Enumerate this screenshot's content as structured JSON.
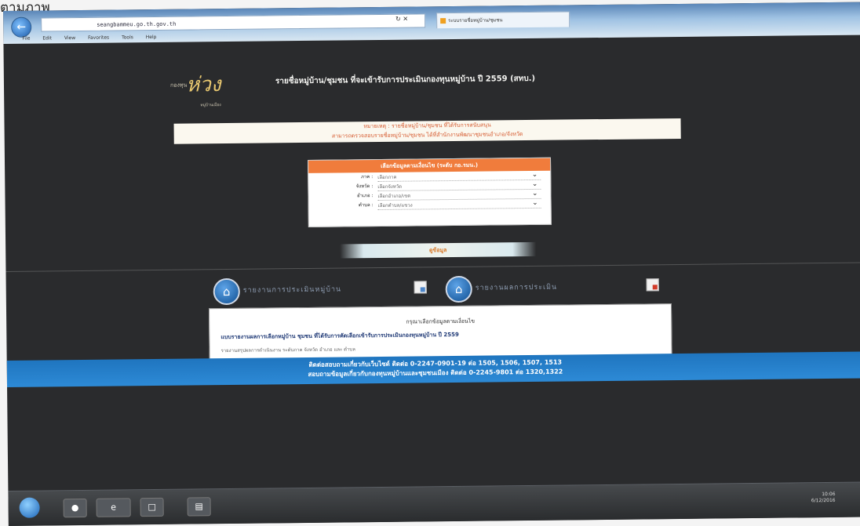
{
  "caption": "ตามภาพ",
  "browser": {
    "url": "seangbammeu.go.th.gov.th",
    "tab_label": "ระบบรายชื่อหมู่บ้าน/ชุมชน",
    "menu": [
      "File",
      "Edit",
      "View",
      "Favorites",
      "Tools",
      "Help"
    ]
  },
  "site": {
    "logo_top": "กองทุน",
    "logo_text": "ห่วง",
    "logo_sub": "หมู่บ้านเมือง",
    "title": "รายชื่อหมู่บ้าน/ชุมชน ที่จะเข้ารับการประเมินกองทุนหมู่บ้าน ปี 2559 (สทบ.)"
  },
  "notice": {
    "line1": "หมายเหตุ : รายชื่อหมู่บ้าน/ชุมชน ที่ได้รับการสนับสนุน",
    "line2": "สามารถตรวจสอบรายชื่อหมู่บ้าน/ชุมชน ได้ที่สำนักงานพัฒนาชุมชนอำเภอ/จังหวัด"
  },
  "form": {
    "title": "เลือกข้อมูลตามเงื่อนไข (ระดับ กอ.รมน.)",
    "rows": [
      {
        "label": "ภาค :",
        "value": "เลือกภาค"
      },
      {
        "label": "จังหวัด :",
        "value": "เลือกจังหวัด"
      },
      {
        "label": "อำเภอ :",
        "value": "เลือกอำเภอ/เขต"
      },
      {
        "label": "ตำบล :",
        "value": "เลือกตำบล/แขวง"
      }
    ]
  },
  "search_button": "ดูข้อมูล",
  "nav": [
    {
      "label": "รายงานการประเมินหมู่บ้าน"
    },
    {
      "label": "รายงานผลการประเมิน"
    }
  ],
  "info": {
    "heading": "กรุณาเลือกข้อมูลตามเงื่อนไข",
    "link": "แบบรายงานผลการเลือกหมู่บ้าน ชุมชน ที่ได้รับการคัดเลือกเข้ารับการประเมินกองทุนหมู่บ้าน ปี 2559",
    "sub": "รายงานสรุปผลการดำเนินงาน ระดับภาค จังหวัด อำเภอ และ ตำบล"
  },
  "footer": {
    "line1": "ติดต่อสอบถามเกี่ยวกับเว็บไซต์ ติดต่อ 0-2247-0901-19 ต่อ 1505, 1506, 1507, 1513",
    "line2": "สอบถามข้อมูลเกี่ยวกับกองทุนหมู่บ้านและชุมชนเมือง ติดต่อ 0-2245-9801 ต่อ 1320,1322"
  },
  "taskbar": {
    "clock_time": "10:06",
    "clock_date": "6/12/2016"
  }
}
